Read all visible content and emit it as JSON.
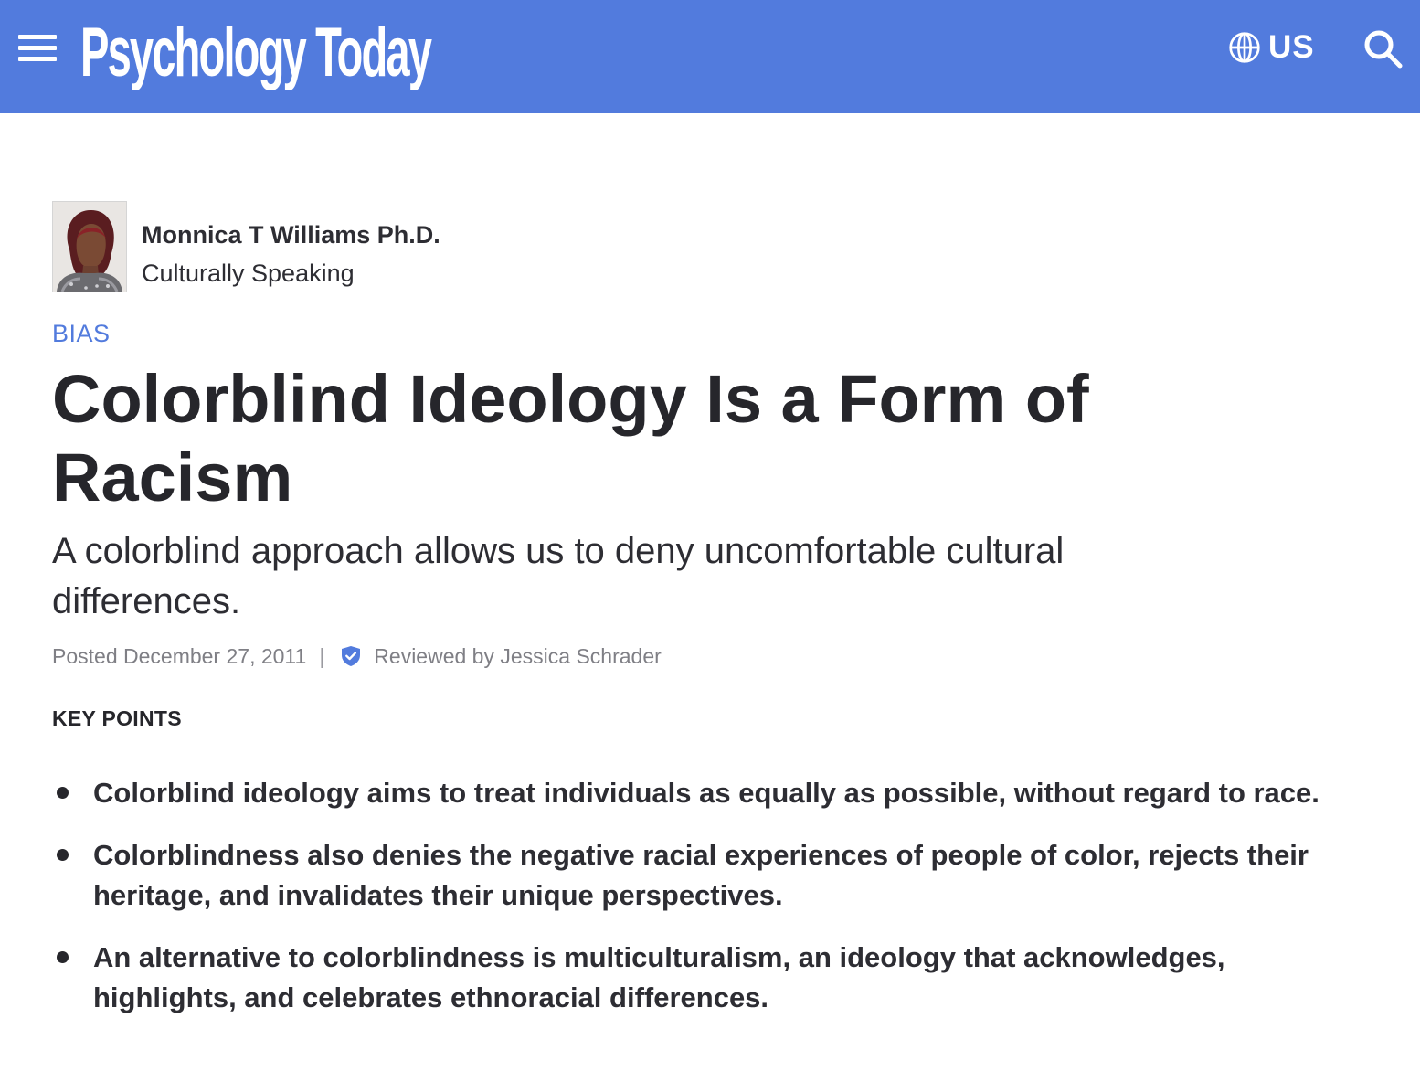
{
  "header": {
    "logo_text": "Psychology Today",
    "region_label": "US",
    "colors": {
      "bar": "#527bdd",
      "text": "#ffffff"
    },
    "icons": [
      "hamburger-menu-icon",
      "globe-icon",
      "search-icon"
    ]
  },
  "author": {
    "name": "Monnica T Williams Ph.D.",
    "blog": "Culturally Speaking"
  },
  "article": {
    "category": "BIAS",
    "title": "Colorblind Ideology Is a Form of Racism",
    "subtitle": "A colorblind approach allows us to deny uncomfortable cultural differences.",
    "posted": "Posted December 27, 2011",
    "separator": "|",
    "reviewed_by": "Reviewed by Jessica Schrader",
    "accent_color": "#527bdd"
  },
  "key_points": {
    "title": "KEY POINTS",
    "items": [
      "Colorblind ideology aims to treat individuals as equally as possible, without regard to race.",
      "Colorblindness also denies the negative racial experiences of people of color, rejects their heritage, and invalidates their unique perspectives.",
      "An alternative to colorblindness is multiculturalism, an ideology that acknowledges, highlights, and celebrates ethnoracial differences."
    ]
  }
}
